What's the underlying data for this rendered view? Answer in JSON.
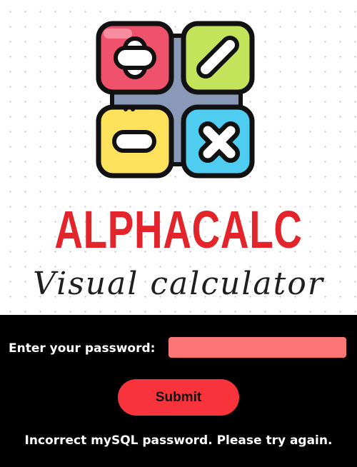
{
  "brand": {
    "title": "ALPHACALC",
    "subtitle": "Visual calculator",
    "logo_tiles": [
      {
        "icon": "plus-icon",
        "color": "#f0516b"
      },
      {
        "icon": "slash-icon",
        "color": "#c2e35a"
      },
      {
        "icon": "minus-icon",
        "color": "#ffe25c"
      },
      {
        "icon": "multiply-icon",
        "color": "#4fcdf1"
      }
    ],
    "logo_backplate_color": "#8a99b8",
    "title_color": "#e3242b"
  },
  "form": {
    "password_label": "Enter your password:",
    "password_value": "",
    "password_placeholder": "",
    "submit_label": "Submit",
    "input_color": "#fb7575",
    "button_color": "#f9333c"
  },
  "status": {
    "message": "Incorrect mySQL password. Please try again."
  }
}
